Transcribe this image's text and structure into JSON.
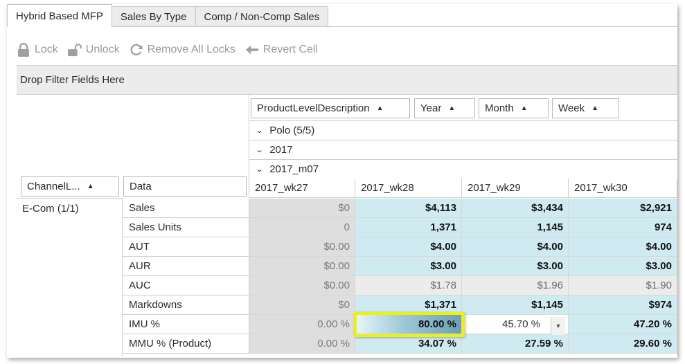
{
  "tabs": [
    {
      "label": "Hybrid Based MFP",
      "active": true
    },
    {
      "label": "Sales By Type"
    },
    {
      "label": "Comp / Non-Comp Sales"
    }
  ],
  "toolbar": {
    "lock": "Lock",
    "unlock": "Unlock",
    "remove_all_locks": "Remove All Locks",
    "revert_cell": "Revert Cell"
  },
  "filter_area": "Drop Filter Fields Here",
  "column_fields": [
    "ProductLevelDescription",
    "Year",
    "Month",
    "Week"
  ],
  "row_fields": {
    "channel": "ChannelL...",
    "data": "Data"
  },
  "groups": [
    "Polo (5/5)",
    "2017",
    "2017_m07"
  ],
  "weeks": [
    "2017_wk27",
    "2017_wk28",
    "2017_wk29",
    "2017_wk30"
  ],
  "channel": "E-Com (1/1)",
  "rows": [
    {
      "label": "Sales",
      "values": [
        "$0",
        "$4,113",
        "$3,434",
        "$2,921"
      ]
    },
    {
      "label": "Sales Units",
      "values": [
        "0",
        "1,371",
        "1,145",
        "974"
      ]
    },
    {
      "label": "AUT",
      "values": [
        "$0.00",
        "$4.00",
        "$4.00",
        "$4.00"
      ]
    },
    {
      "label": "AUR",
      "values": [
        "$0.00",
        "$3.00",
        "$3.00",
        "$3.00"
      ]
    },
    {
      "label": "AUC",
      "values": [
        "$0.00",
        "$1.78",
        "$1.96",
        "$1.90"
      ]
    },
    {
      "label": "Markdowns",
      "values": [
        "$0",
        "$1,371",
        "$1,145",
        "$974"
      ]
    },
    {
      "label": "IMU %",
      "values": [
        "0.00 %",
        "80.00 %",
        "45.70 %",
        "47.20 %"
      ]
    },
    {
      "label": "MMU % (Product)",
      "values": [
        "0.00 %",
        "34.07 %",
        "27.59 %",
        "29.60 %"
      ]
    }
  ],
  "colors": {
    "computed_cell": "#cfeaf0",
    "disabled_cell": "#dedede",
    "highlight_border": "#ecf20c"
  }
}
